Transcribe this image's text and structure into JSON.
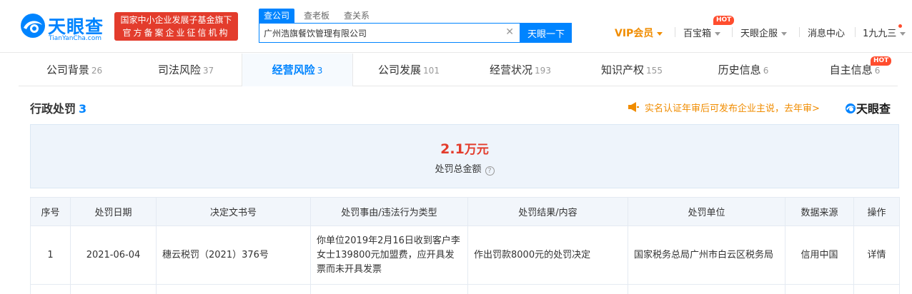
{
  "header": {
    "logo_text": "天眼查",
    "logo_sub": "TianYanCha.com",
    "badge_line1": "国家中小企业发展子基金旗下",
    "badge_line2": "官方备案企业征信机构",
    "search_tabs": [
      "查公司",
      "查老板",
      "查关系"
    ],
    "search_value": "广州浩旗餐饮管理有限公司",
    "search_button": "天眼一下",
    "nav": {
      "vip": "VIP会员",
      "baibaoxiang": "百宝箱",
      "hot": "HOT",
      "qifu": "天眼企服",
      "messages": "消息中心",
      "user": "1九九三"
    }
  },
  "tabs": [
    {
      "label": "公司背景",
      "count": "26"
    },
    {
      "label": "司法风险",
      "count": "37"
    },
    {
      "label": "经营风险",
      "count": "3"
    },
    {
      "label": "公司发展",
      "count": "101"
    },
    {
      "label": "经营状况",
      "count": "193"
    },
    {
      "label": "知识产权",
      "count": "155"
    },
    {
      "label": "历史信息",
      "count": "6"
    },
    {
      "label": "自主信息",
      "count": "6"
    }
  ],
  "active_tab": "经营风险",
  "section": {
    "title": "行政处罚",
    "count": "3",
    "promo": "实名认证年审后可发布企业主说，去年审>",
    "mini_logo": "天眼查"
  },
  "summary": {
    "amount": "2.1",
    "unit": "万元",
    "label": "处罚总金额",
    "help": "?"
  },
  "table": {
    "headers": [
      "序号",
      "处罚日期",
      "决定文书号",
      "处罚事由/违法行为类型",
      "处罚结果/内容",
      "处罚单位",
      "数据来源",
      "操作"
    ],
    "rows": [
      {
        "index": "1",
        "date": "2021-06-04",
        "doc": "穗云税罚（2021）376号",
        "reason": "你单位2019年2月16日收到客户李女士139800元加盟费，应开具发票而未开具发票",
        "result": "作出罚款8000元的处罚决定",
        "org": "国家税务总局广州市白云区税务局",
        "source": "信用中国",
        "action": "详情"
      }
    ]
  },
  "colors": {
    "brand": "#0084ff",
    "red": "#e33c2c",
    "vip": "#f08c00"
  }
}
